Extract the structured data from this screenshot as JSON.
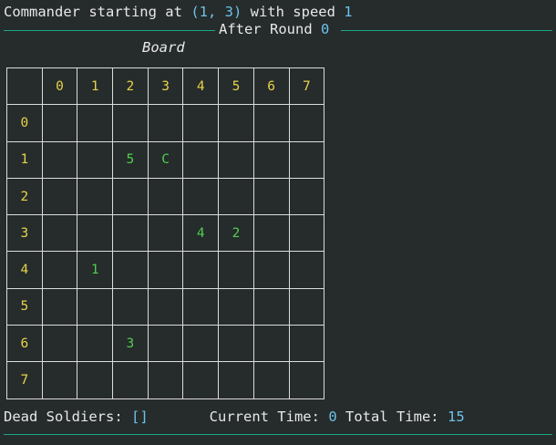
{
  "header": {
    "prefix": "Commander starting at ",
    "position": "(1, 3)",
    "middle": " with speed ",
    "speed": "1"
  },
  "round_banner": {
    "label": "After Round ",
    "round": "0"
  },
  "board": {
    "title": "Board",
    "column_headers": [
      "0",
      "1",
      "2",
      "3",
      "4",
      "5",
      "6",
      "7"
    ],
    "rows": [
      {
        "label": "0",
        "cells": [
          "",
          "",
          "",
          "",
          "",
          "",
          "",
          ""
        ]
      },
      {
        "label": "1",
        "cells": [
          "",
          "",
          "5",
          "C",
          "",
          "",
          "",
          ""
        ]
      },
      {
        "label": "2",
        "cells": [
          "",
          "",
          "",
          "",
          "",
          "",
          "",
          ""
        ]
      },
      {
        "label": "3",
        "cells": [
          "",
          "",
          "",
          "",
          "4",
          "2",
          "",
          ""
        ]
      },
      {
        "label": "4",
        "cells": [
          "",
          "1",
          "",
          "",
          "",
          "",
          "",
          ""
        ]
      },
      {
        "label": "5",
        "cells": [
          "",
          "",
          "",
          "",
          "",
          "",
          "",
          ""
        ]
      },
      {
        "label": "6",
        "cells": [
          "",
          "",
          "3",
          "",
          "",
          "",
          "",
          ""
        ]
      },
      {
        "label": "7",
        "cells": [
          "",
          "",
          "",
          "",
          "",
          "",
          "",
          ""
        ]
      }
    ]
  },
  "status": {
    "dead_label": "Dead Soldiers: ",
    "dead_value": "[]",
    "current_label": "Current Time: ",
    "current_value": "0",
    "total_label": " Total Time: ",
    "total_value": "15"
  },
  "colors": {
    "background": "#262b2b",
    "rule": "#19a889",
    "number": "#6cc3e8",
    "header_index": "#e6d44a",
    "soldier": "#4fcf4f"
  }
}
